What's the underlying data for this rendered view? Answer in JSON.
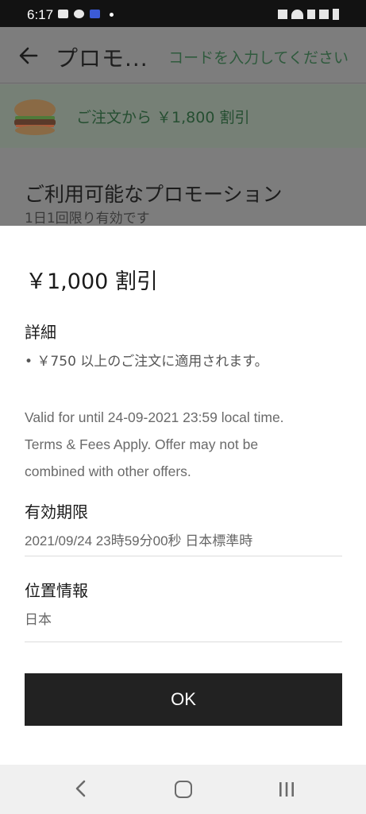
{
  "status_bar": {
    "time": "6:17"
  },
  "app_bar": {
    "title": "プロモ...",
    "enter_code_label": "コードを入力してください"
  },
  "promo_banner": {
    "text": "ご注文から ￥1,800 割引"
  },
  "available": {
    "title": "ご利用可能なプロモーション",
    "subtitle": "1日1回限り有効です"
  },
  "sheet": {
    "discount_title": "￥1,000 割引",
    "details_label": "詳細",
    "detail_items": [
      "• ￥750 以上のご注文に適用されます。"
    ],
    "terms_lines": [
      "Valid for until 24-09-2021 23:59 local time.",
      "Terms & Fees Apply. Offer may not be",
      "combined with other offers."
    ],
    "validity_label": "有効期限",
    "validity_value": "2021/09/24 23時59分00秒 日本標準時",
    "location_label": "位置情報",
    "location_value": "日本",
    "ok_label": "OK"
  },
  "icons": [
    "back-arrow-icon",
    "burger-image",
    "nav-back-icon",
    "nav-home-icon",
    "nav-recent-icon"
  ],
  "colors": {
    "ok_button_bg": "#222222",
    "scrim": "#7d7d7d",
    "banner_text": "#254e31"
  }
}
